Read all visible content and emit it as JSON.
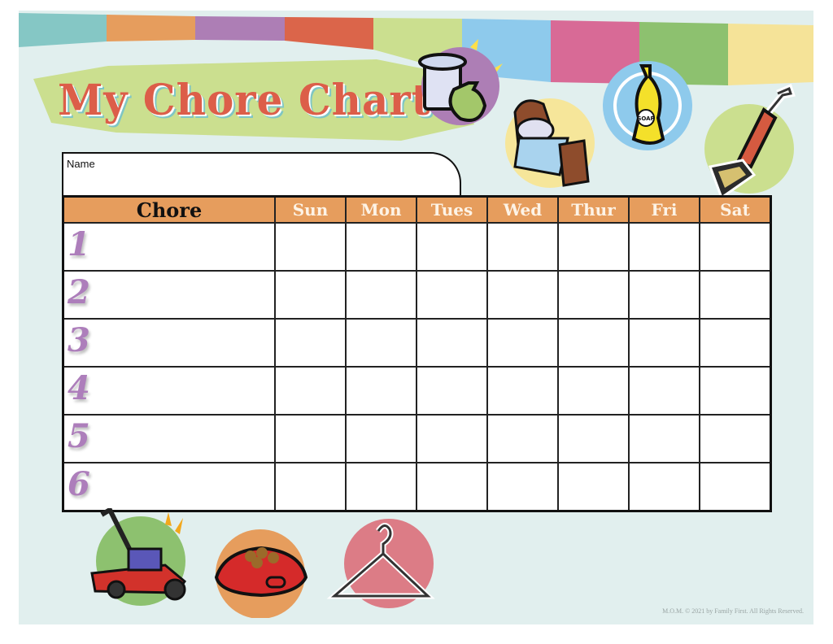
{
  "page": {
    "title": "My Chore Chart",
    "name_label": "Name",
    "footer": "M.O.M. © 2021 by Family First. All Rights Reserved.",
    "colors": {
      "background": "#e1efee",
      "title": "#dc5e49",
      "header": "#e69d5d",
      "row_number": "#ad7ebb",
      "banner": "#cbdf8f",
      "stripes": [
        "#85c7c5",
        "#e69d5d",
        "#ad7eb5",
        "#db654a",
        "#cbdf8f",
        "#8ecaec",
        "#d86a96",
        "#8dc16f",
        "#f5e398"
      ]
    }
  },
  "table": {
    "chore_header": "Chore",
    "days": [
      "Sun",
      "Mon",
      "Tues",
      "Wed",
      "Thur",
      "Fri",
      "Sat"
    ],
    "rows": [
      {
        "number": "1",
        "chore": "",
        "checks": [
          "",
          "",
          "",
          "",
          "",
          "",
          ""
        ]
      },
      {
        "number": "2",
        "chore": "",
        "checks": [
          "",
          "",
          "",
          "",
          "",
          "",
          ""
        ]
      },
      {
        "number": "3",
        "chore": "",
        "checks": [
          "",
          "",
          "",
          "",
          "",
          "",
          ""
        ]
      },
      {
        "number": "4",
        "chore": "",
        "checks": [
          "",
          "",
          "",
          "",
          "",
          "",
          ""
        ]
      },
      {
        "number": "5",
        "chore": "",
        "checks": [
          "",
          "",
          "",
          "",
          "",
          "",
          ""
        ]
      },
      {
        "number": "6",
        "chore": "",
        "checks": [
          "",
          "",
          "",
          "",
          "",
          "",
          ""
        ]
      }
    ]
  },
  "icons": {
    "top": [
      "trash-can-icon",
      "bed-icon",
      "dish-soap-icon",
      "vacuum-icon"
    ],
    "bottom": [
      "lawn-mower-icon",
      "pet-food-bowl-icon",
      "clothes-hanger-icon"
    ],
    "soap_label": "SOAP"
  }
}
